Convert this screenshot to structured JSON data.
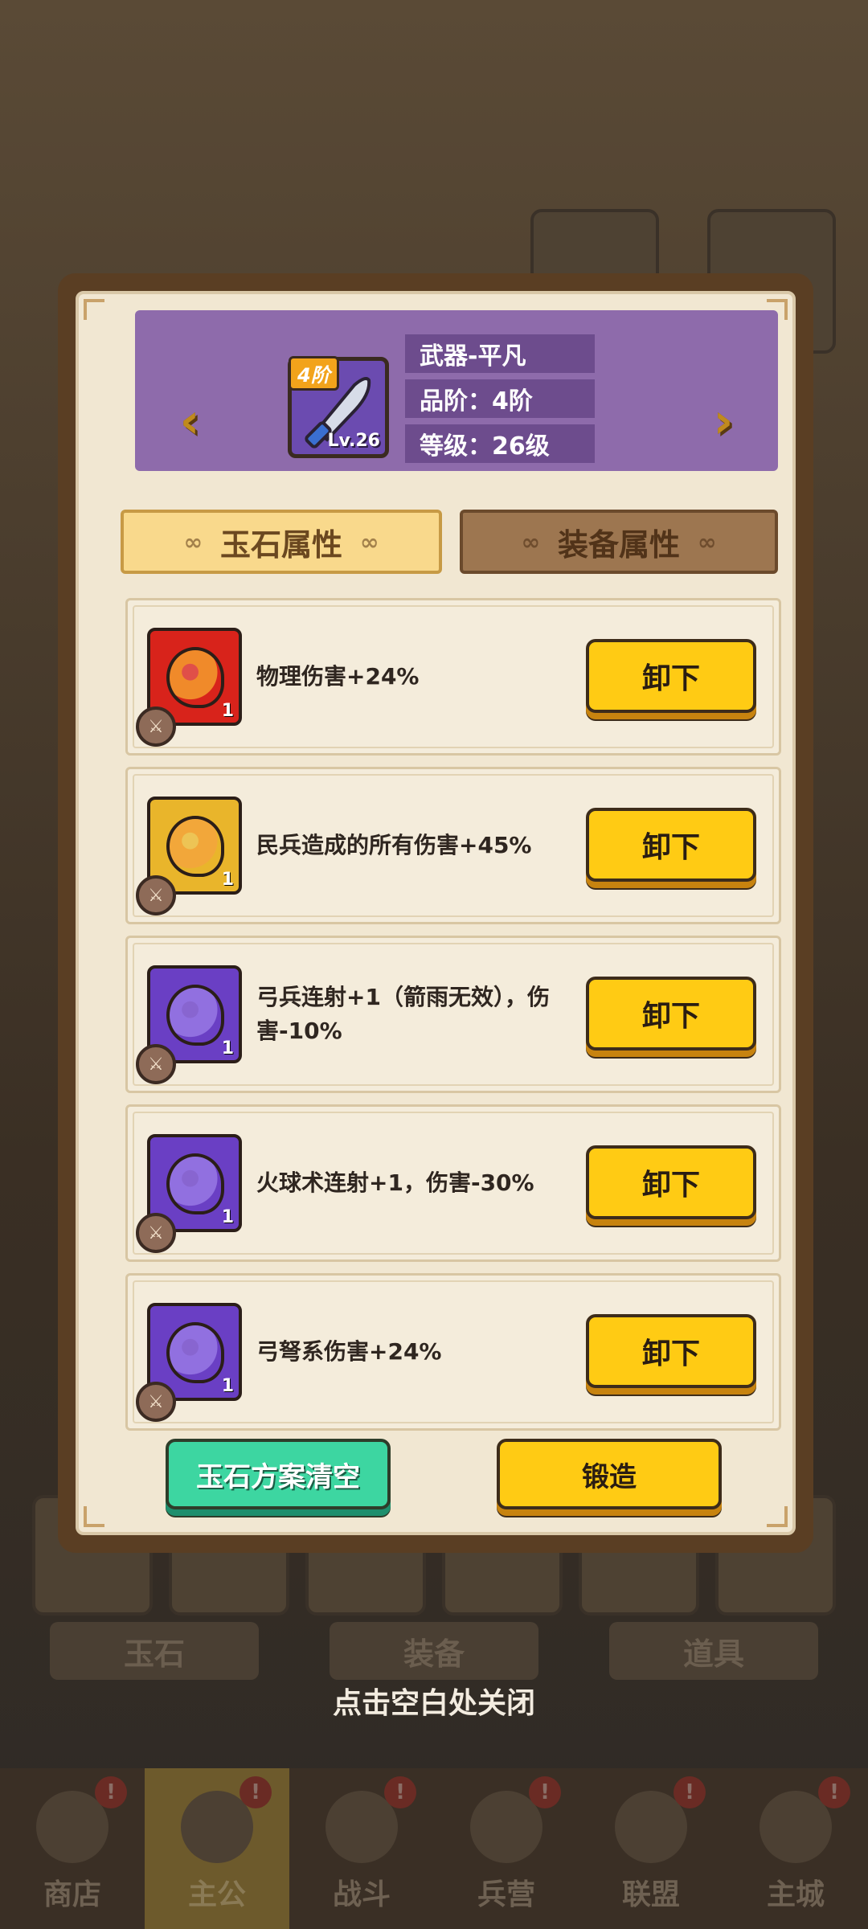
{
  "background": {
    "tabs": [
      "玉石",
      "装备",
      "道具"
    ],
    "nav": [
      {
        "label": "商店",
        "active": false,
        "badge": true
      },
      {
        "label": "主公",
        "active": true,
        "badge": true
      },
      {
        "label": "战斗",
        "active": false,
        "badge": true
      },
      {
        "label": "兵营",
        "active": false,
        "badge": true
      },
      {
        "label": "联盟",
        "active": false,
        "badge": true
      },
      {
        "label": "主城",
        "active": false,
        "badge": true
      }
    ],
    "badge_glyph": "!"
  },
  "header": {
    "item_tier_badge": "4阶",
    "item_level": "Lv.26",
    "name": "武器-平凡",
    "quality": "品阶：4阶",
    "level": "等级：26级",
    "prev_arrow": "‹",
    "next_arrow": "›"
  },
  "tabs": {
    "active": "玉石属性",
    "inactive": "装备属性",
    "swirl": "∞"
  },
  "jades": [
    {
      "desc": "物理伤害+24%",
      "count": "1",
      "color": "#d8231b",
      "gem_color": "#f08a2a",
      "button": "卸下"
    },
    {
      "desc": "民兵造成的所有伤害+45%",
      "count": "1",
      "color": "#e9b52b",
      "gem_color": "#f2a73a",
      "button": "卸下"
    },
    {
      "desc": "弓兵连射+1（箭雨无效），伤害-10%",
      "count": "1",
      "color": "#6a3fc4",
      "gem_color": "#9170e0",
      "button": "卸下"
    },
    {
      "desc": "火球术连射+1，伤害-30%",
      "count": "1",
      "color": "#6a3fc4",
      "gem_color": "#9170e0",
      "button": "卸下"
    },
    {
      "desc": "弓弩系伤害+24%",
      "count": "1",
      "color": "#6a3fc4",
      "gem_color": "#9170e0",
      "button": "卸下"
    }
  ],
  "buttons": {
    "clear": "玉石方案清空",
    "forge": "锻造"
  },
  "close_hint": "点击空白处关闭"
}
